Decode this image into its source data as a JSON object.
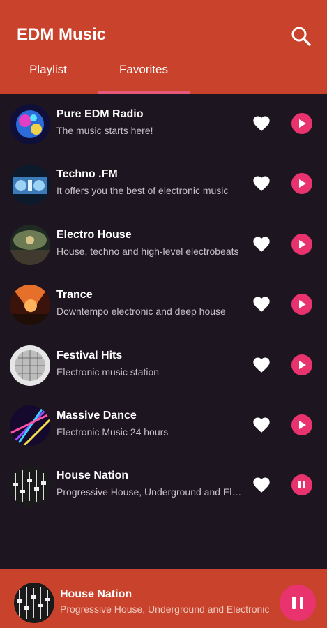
{
  "app": {
    "title": "EDM Music"
  },
  "tabs": [
    {
      "label": "Playlist"
    },
    {
      "label": "Favorites",
      "active": true
    }
  ],
  "stations": [
    {
      "title": "Pure EDM Radio",
      "subtitle": "The music starts here!",
      "state": "play",
      "icon": "stage-lights"
    },
    {
      "title": "Techno .FM",
      "subtitle": "It offers you the best of electronic music",
      "state": "play",
      "icon": "dj-mixer"
    },
    {
      "title": "Electro House",
      "subtitle": "House, techno and high-level electrobeats",
      "state": "play",
      "icon": "crowd-stage"
    },
    {
      "title": "Trance",
      "subtitle": "Downtempo electronic and deep house",
      "state": "play",
      "icon": "concert-orange"
    },
    {
      "title": "Festival Hits",
      "subtitle": "Electronic music station",
      "state": "play",
      "icon": "disco-ball"
    },
    {
      "title": "Massive Dance",
      "subtitle": "Electronic Music 24 hours",
      "state": "play",
      "icon": "lasers"
    },
    {
      "title": "House Nation",
      "subtitle": "Progressive House, Underground and Electronic",
      "state": "pause",
      "icon": "mixer-faders"
    }
  ],
  "now_playing": {
    "title": "House Nation",
    "subtitle": "Progressive House, Underground and Electronic",
    "state": "pause"
  },
  "colors": {
    "appbar": "#c9432c",
    "background": "#1d1520",
    "accent": "#e8336e"
  }
}
